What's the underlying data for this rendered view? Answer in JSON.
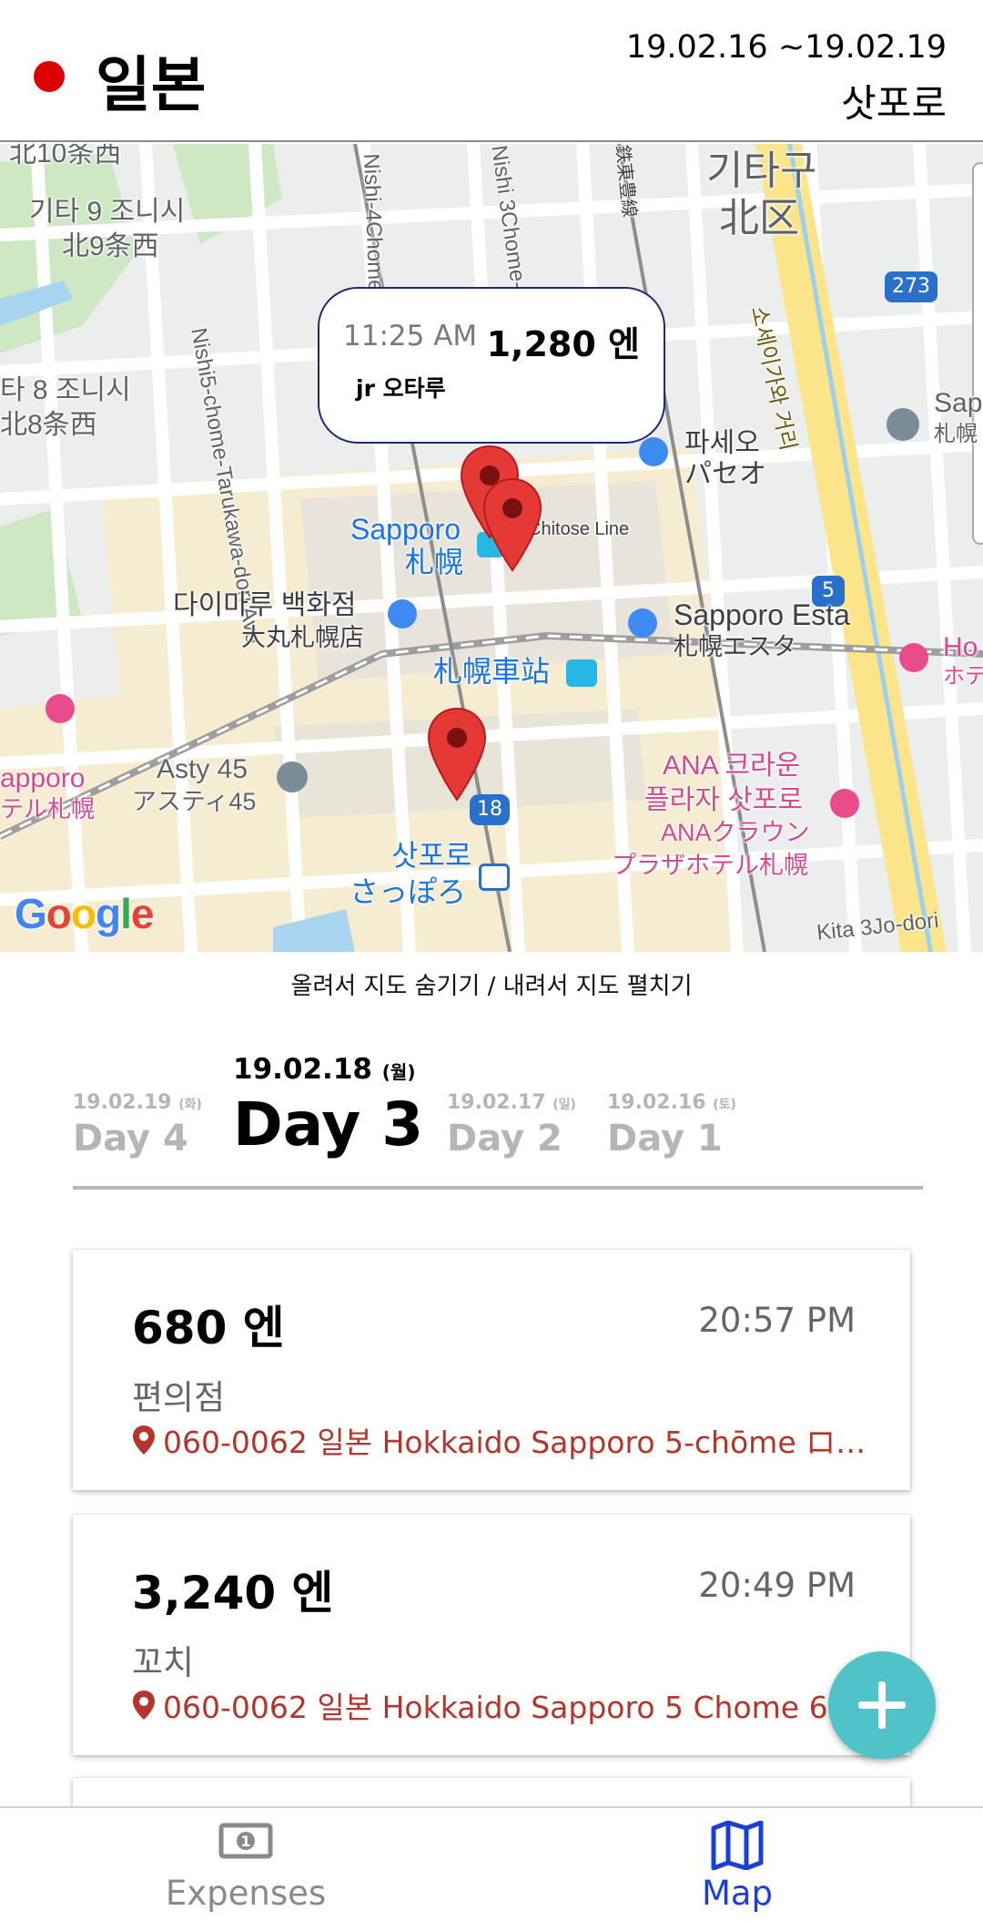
{
  "header": {
    "country": "일본",
    "date_range": "19.02.16 ~19.02.19",
    "city": "삿포로",
    "flag_color": "#dd0000"
  },
  "map": {
    "labels": {
      "kita10": "北10条西",
      "kita9_kr": "기타 9 조니시",
      "kita9_jp": "北9条西",
      "kita8_kr": "타 8 조니시",
      "kita8_jp": "北8条西",
      "nishi5": "Nishi5-chome-Tarukawa-dori Ave",
      "nishi4": "Nishi-4Chome",
      "nishi3": "Nishi 3Chome-dori",
      "sotetsu": "鉄東豊線",
      "kitaku_kr": "기타구",
      "kitaku_jp": "北区",
      "road273": "273",
      "soseigawa": "소세이가와 거리",
      "paseo_kr": "파세오",
      "paseo_jp": "パセオ",
      "sapporo_po": "Sapporo Po",
      "sapporo_po2": "札幌",
      "sapporo_en": "Sapporo",
      "sapporo_jp": "札幌",
      "chitose": "Chitose Line",
      "road5": "5",
      "daimaru_kr": "다이마루 백화점",
      "daimaru_jp": "大丸札幌店",
      "esta_en": "Sapporo Esta",
      "esta_jp": "札幌エスタ",
      "hotel_right": "Ho",
      "hotel_right2": "ホテ",
      "station_jp": "札幌車站",
      "asty_en": "Asty 45",
      "asty_jp": "アスティ45",
      "apporo": "apporo",
      "hotel_sapporo": "テル札幌",
      "road18": "18",
      "ana1": "ANA 크라운",
      "ana2": "플라자 삿포로",
      "ana3": "ANAクラウン",
      "ana4": "プラザホテル札幌",
      "sapporo_sub_kr": "삿포로",
      "sapporo_sub_jp": "さっぽろ",
      "kita3": "Kita 3Jo-dori",
      "google": "Google"
    },
    "callout": {
      "time": "11:25 AM",
      "amount": "1,280 엔",
      "place": "jr 오타루"
    },
    "pin_color": "#e53935"
  },
  "hint": "올려서 지도 숨기기 / 내려서 지도 펼치기",
  "tabs": [
    {
      "date": "19.02.19",
      "weekday": "(화)",
      "name": "Day 4",
      "active": false
    },
    {
      "date": "19.02.18",
      "weekday": "(월)",
      "name": "Day 3",
      "active": true
    },
    {
      "date": "19.02.17",
      "weekday": "(일)",
      "name": "Day 2",
      "active": false
    },
    {
      "date": "19.02.16",
      "weekday": "(토)",
      "name": "Day 1",
      "active": false
    }
  ],
  "expenses": [
    {
      "amount": "680 엔",
      "time": "20:57 PM",
      "category": "편의점",
      "address": "060-0062 일본 Hokkaido Sapporo 5-chōme ロジ..."
    },
    {
      "amount": "3,240 엔",
      "time": "20:49 PM",
      "category": "꼬치",
      "address": "060-0062 일본 Hokkaido Sapporo 5 Chome  6"
    }
  ],
  "fab": {
    "icon": "plus-icon",
    "color": "#4fc3c7"
  },
  "bottom_nav": [
    {
      "label": "Expenses",
      "icon": "money-icon",
      "active": false
    },
    {
      "label": "Map",
      "icon": "map-icon",
      "active": true
    }
  ],
  "colors": {
    "active_nav": "#1b3fd6",
    "inactive_nav": "#8a8a8a",
    "address": "#b3352b"
  }
}
